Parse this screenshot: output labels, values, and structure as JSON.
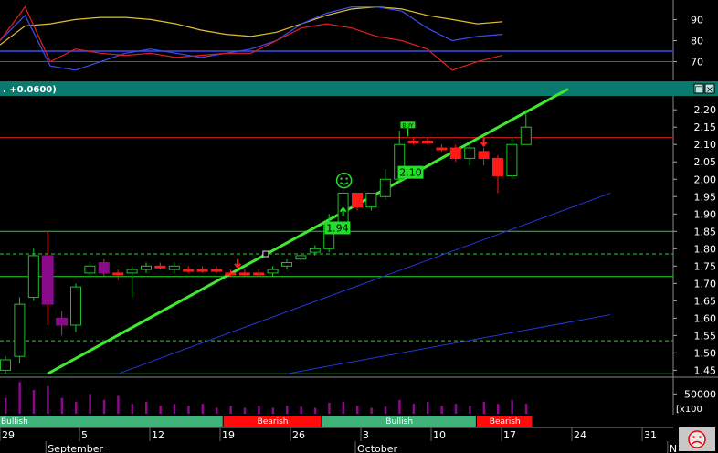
{
  "panel_header": {
    "value_text": ". +0.0600)",
    "button_restore": "□",
    "button_close": "×"
  },
  "colors": {
    "background": "#000000",
    "header_bg": "#0b7a6e",
    "bull": "#000000",
    "bull_stroke": "#1fbf2a",
    "bear": "#ff1a1a",
    "flat": "#ff1a1a",
    "trend_main": "#41e832",
    "trend_blue": "#2236d8",
    "volume": "#8a0b8a",
    "band_bull": "#3fb27a",
    "band_bear": "#ff0b0b",
    "resistance_red": "#d81b1b",
    "support_green": "#22d822",
    "osc_yellow": "#e0c030",
    "osc_blue": "#3a4ef0",
    "osc_red": "#e02020"
  },
  "badges": {
    "smiley_icon": "smiley-icon",
    "sad_icon": "sad-face-icon",
    "label_194": "1.94",
    "label_210": "2.10",
    "buy_tag": "BUY"
  },
  "chart_data": [
    {
      "type": "line",
      "name": "oscillator",
      "ylim": [
        62,
        98
      ],
      "yticks": [
        70,
        80,
        90
      ],
      "hlines": [
        75,
        70
      ],
      "series": [
        {
          "color": "yellow",
          "values": [
            78,
            87,
            88,
            90,
            91,
            91,
            90,
            88,
            85,
            83,
            82,
            84,
            88,
            92,
            95,
            96,
            95,
            92,
            90,
            88,
            89
          ]
        },
        {
          "color": "blue",
          "values": [
            80,
            92,
            68,
            66,
            70,
            74,
            76,
            74,
            72,
            74,
            76,
            80,
            88,
            93,
            96,
            96,
            94,
            86,
            80,
            82,
            83
          ]
        },
        {
          "color": "red",
          "values": [
            80,
            96,
            70,
            76,
            74,
            73,
            74,
            72,
            73,
            74,
            74,
            80,
            86,
            88,
            86,
            82,
            80,
            76,
            66,
            70,
            73
          ]
        }
      ]
    },
    {
      "type": "candlestick",
      "name": "price",
      "ylim": [
        1.43,
        2.24
      ],
      "yticks": [
        "1.45",
        "1.50",
        "1.55",
        "1.60",
        "1.65",
        "1.70",
        "1.75",
        "1.80",
        "1.85",
        "1.90",
        "1.95",
        "2.00",
        "2.05",
        "2.10",
        "2.15",
        "2.20"
      ],
      "candles": [
        {
          "o": 1.45,
          "h": 1.49,
          "l": 1.44,
          "c": 1.48,
          "t": "bull"
        },
        {
          "o": 1.49,
          "h": 1.66,
          "l": 1.47,
          "c": 1.64,
          "t": "bull"
        },
        {
          "o": 1.66,
          "h": 1.8,
          "l": 1.65,
          "c": 1.78,
          "t": "bull"
        },
        {
          "o": 1.78,
          "h": 1.85,
          "l": 1.58,
          "c": 1.64,
          "t": "bear"
        },
        {
          "o": 1.6,
          "h": 1.62,
          "l": 1.55,
          "c": 1.58,
          "t": "bear"
        },
        {
          "o": 1.58,
          "h": 1.7,
          "l": 1.56,
          "c": 1.69,
          "t": "bull"
        },
        {
          "o": 1.73,
          "h": 1.76,
          "l": 1.72,
          "c": 1.75,
          "t": "bull"
        },
        {
          "o": 1.76,
          "h": 1.77,
          "l": 1.72,
          "c": 1.73,
          "t": "bear"
        },
        {
          "o": 1.73,
          "h": 1.74,
          "l": 1.71,
          "c": 1.73,
          "t": "flat"
        },
        {
          "o": 1.73,
          "h": 1.75,
          "l": 1.66,
          "c": 1.74,
          "t": "bull"
        },
        {
          "o": 1.74,
          "h": 1.76,
          "l": 1.73,
          "c": 1.75,
          "t": "bull"
        },
        {
          "o": 1.75,
          "h": 1.76,
          "l": 1.74,
          "c": 1.75,
          "t": "flat"
        },
        {
          "o": 1.74,
          "h": 1.76,
          "l": 1.73,
          "c": 1.75,
          "t": "bull"
        },
        {
          "o": 1.74,
          "h": 1.75,
          "l": 1.73,
          "c": 1.74,
          "t": "flat"
        },
        {
          "o": 1.74,
          "h": 1.75,
          "l": 1.73,
          "c": 1.74,
          "t": "flat"
        },
        {
          "o": 1.74,
          "h": 1.75,
          "l": 1.73,
          "c": 1.74,
          "t": "flat"
        },
        {
          "o": 1.73,
          "h": 1.74,
          "l": 1.72,
          "c": 1.73,
          "t": "flat"
        },
        {
          "o": 1.73,
          "h": 1.74,
          "l": 1.72,
          "c": 1.73,
          "t": "flat"
        },
        {
          "o": 1.73,
          "h": 1.74,
          "l": 1.72,
          "c": 1.73,
          "t": "flat"
        },
        {
          "o": 1.73,
          "h": 1.75,
          "l": 1.72,
          "c": 1.74,
          "t": "bull"
        },
        {
          "o": 1.75,
          "h": 1.77,
          "l": 1.74,
          "c": 1.76,
          "t": "bull"
        },
        {
          "o": 1.77,
          "h": 1.79,
          "l": 1.76,
          "c": 1.78,
          "t": "bull"
        },
        {
          "o": 1.79,
          "h": 1.81,
          "l": 1.78,
          "c": 1.8,
          "t": "bull"
        },
        {
          "o": 1.8,
          "h": 1.9,
          "l": 1.79,
          "c": 1.87,
          "t": "bull"
        },
        {
          "o": 1.87,
          "h": 1.97,
          "l": 1.86,
          "c": 1.96,
          "t": "bull"
        },
        {
          "o": 1.96,
          "h": 1.96,
          "l": 1.91,
          "c": 1.92,
          "t": "bear"
        },
        {
          "o": 1.92,
          "h": 1.96,
          "l": 1.91,
          "c": 1.96,
          "t": "bull"
        },
        {
          "o": 1.95,
          "h": 2.03,
          "l": 1.94,
          "c": 2.0,
          "t": "bull"
        },
        {
          "o": 2.0,
          "h": 2.14,
          "l": 1.99,
          "c": 2.1,
          "t": "bull"
        },
        {
          "o": 2.11,
          "h": 2.12,
          "l": 2.1,
          "c": 2.11,
          "t": "flat"
        },
        {
          "o": 2.11,
          "h": 2.12,
          "l": 2.1,
          "c": 2.11,
          "t": "flat"
        },
        {
          "o": 2.09,
          "h": 2.1,
          "l": 2.08,
          "c": 2.09,
          "t": "flat"
        },
        {
          "o": 2.09,
          "h": 2.1,
          "l": 2.05,
          "c": 2.06,
          "t": "bear"
        },
        {
          "o": 2.06,
          "h": 2.11,
          "l": 2.04,
          "c": 2.09,
          "t": "bull"
        },
        {
          "o": 2.08,
          "h": 2.09,
          "l": 2.04,
          "c": 2.06,
          "t": "bear"
        },
        {
          "o": 2.06,
          "h": 2.07,
          "l": 1.96,
          "c": 2.01,
          "t": "bear"
        },
        {
          "o": 2.01,
          "h": 2.12,
          "l": 2.0,
          "c": 2.1,
          "t": "bull"
        },
        {
          "o": 2.1,
          "h": 2.2,
          "l": 2.1,
          "c": 2.15,
          "t": "bull"
        }
      ],
      "hlines": [
        {
          "y": 2.12,
          "style": "solid",
          "color": "red"
        },
        {
          "y": 1.85,
          "style": "solid",
          "color": "green"
        },
        {
          "y": 1.785,
          "style": "dashed",
          "color": "green"
        },
        {
          "y": 1.72,
          "style": "solid",
          "color": "green"
        },
        {
          "y": 1.535,
          "style": "dashed",
          "color": "green"
        },
        {
          "y": 1.44,
          "style": "solid",
          "color": "green"
        }
      ],
      "trendlines": [
        {
          "from": [
            3,
            1.44
          ],
          "to": [
            40,
            2.26
          ],
          "color": "green",
          "width": 3
        },
        {
          "from": [
            8,
            1.44
          ],
          "to": [
            43,
            1.96
          ],
          "color": "blue",
          "width": 1
        },
        {
          "from": [
            20,
            1.44
          ],
          "to": [
            43,
            1.61
          ],
          "color": "blue",
          "width": 1
        }
      ],
      "annotations": [
        {
          "text": "1.94",
          "x": 23.6,
          "y": 1.86
        },
        {
          "text": "2.10",
          "x": 28.8,
          "y": 2.02
        },
        {
          "text": "BUY",
          "x": 28.6,
          "y": 2.155
        }
      ],
      "sell_arrows": [
        {
          "x": 16.5,
          "y": 1.77
        },
        {
          "x": 34.0,
          "y": 2.12
        }
      ],
      "buy_arrows": [
        {
          "x": 24.0,
          "y": 1.92
        }
      ],
      "marker_square": {
        "x": 18.5,
        "y": 1.785
      }
    },
    {
      "type": "bar",
      "name": "volume",
      "ylim": [
        0,
        90000
      ],
      "yticks": [
        "50000"
      ],
      "unit_label": "x100",
      "values": [
        40000,
        80000,
        60000,
        70000,
        40000,
        30000,
        50000,
        35000,
        45000,
        25000,
        30000,
        20000,
        25000,
        20000,
        25000,
        15000,
        20000,
        15000,
        20000,
        15000,
        20000,
        18000,
        15000,
        28000,
        30000,
        20000,
        15000,
        18000,
        35000,
        25000,
        30000,
        20000,
        25000,
        20000,
        30000,
        25000,
        35000,
        25000
      ]
    }
  ],
  "trend_bands": [
    {
      "label": "Bullish",
      "from": 0,
      "to": 15.5,
      "kind": "bull"
    },
    {
      "label": "Bearish",
      "from": 15.5,
      "to": 22.5,
      "kind": "bear"
    },
    {
      "label": "Bullish",
      "from": 22.5,
      "to": 33.5,
      "kind": "bull"
    },
    {
      "label": "Bearish",
      "from": 33.5,
      "to": 37.5,
      "kind": "bear"
    }
  ],
  "x_axis": {
    "days": [
      {
        "label": "29",
        "x": 0.0
      },
      {
        "label": "5",
        "x": 5.0
      },
      {
        "label": "12",
        "x": 10.0
      },
      {
        "label": "19",
        "x": 15.0
      },
      {
        "label": "26",
        "x": 20.0
      },
      {
        "label": "3",
        "x": 25.0
      },
      {
        "label": "10",
        "x": 30.0
      },
      {
        "label": "17",
        "x": 35.0
      },
      {
        "label": "24",
        "x": 40.0
      },
      {
        "label": "31",
        "x": 45.0
      }
    ],
    "months": [
      {
        "label": "September",
        "x": 3.0
      },
      {
        "label": "October",
        "x": 25.0
      },
      {
        "label": "N",
        "x": 47.2
      }
    ]
  }
}
